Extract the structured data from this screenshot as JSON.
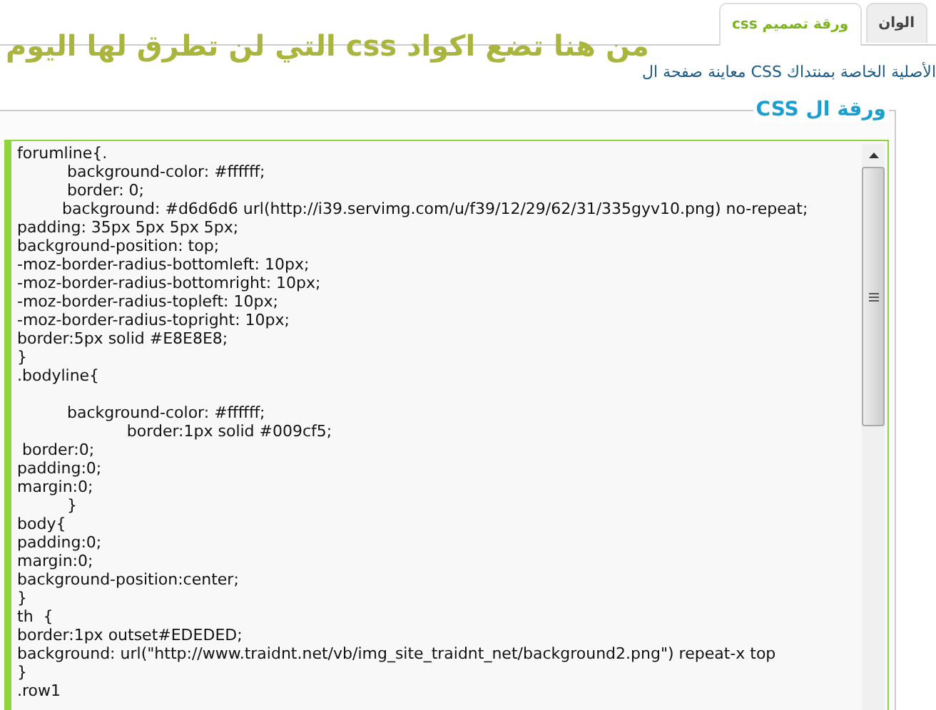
{
  "heading": "من هنا تضع اكواد css التي لن تطرق لها اليوم",
  "tabs": [
    {
      "label": "الوان",
      "selected": false
    },
    {
      "label": "ورقة تصميم css",
      "selected": true
    }
  ],
  "preview_link": "معاينة صفحة ال CSS الأصلية الخاصة بمنتداك",
  "section": {
    "legend": "ورقة ال CSS",
    "code": "forumline{.\n          background-color: #ffffff;\n          border: 0;\n         background: #d6d6d6 url(http://i39.servimg.com/u/f39/12/29/62/31/335gyv10.png) no-repeat;\npadding: 35px 5px 5px 5px;\nbackground-position: top;\n-moz-border-radius-bottomleft: 10px;\n-moz-border-radius-bottomright: 10px;\n-moz-border-radius-topleft: 10px;\n-moz-border-radius-topright: 10px;\nborder:5px solid #E8E8E8;\n}\n.bodyline{\n\n          background-color: #ffffff;\n                      border:1px solid #009cf5;\n border:0;\npadding:0;\nmargin:0;\n          }\nbody{\npadding:0;\nmargin:0;\nbackground-position:center;\n}\nth  {\nborder:1px outset#EDEDED;\nbackground: url(\"http://www.traidnt.net/vb/img_site_traidnt_net/background2.png\") repeat-x top\n}\n.row1"
  }
}
